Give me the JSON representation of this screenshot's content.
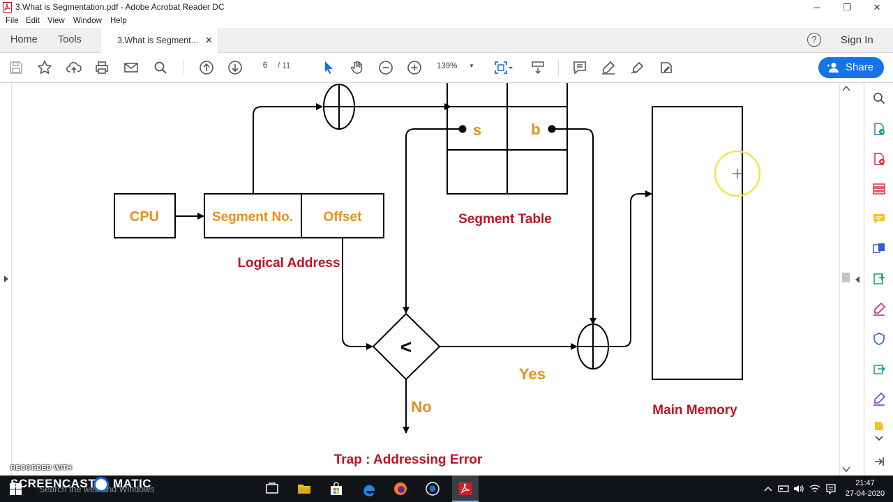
{
  "window": {
    "title": "3.What is Segmentation.pdf - Adobe Acrobat Reader DC",
    "minimize": "─",
    "restore": "❐",
    "close": "✕"
  },
  "menu": [
    "File",
    "Edit",
    "View",
    "Window",
    "Help"
  ],
  "tabs": {
    "home": "Home",
    "tools": "Tools",
    "document": "3.What is Segment...",
    "document_close": "✕",
    "help": "?",
    "sign_in": "Sign In"
  },
  "toolbar": {
    "page_current": "6",
    "page_total": "/ 11",
    "zoom": "139%",
    "zoom_arrow": "▼",
    "share": "Share"
  },
  "diagram": {
    "cpu": "CPU",
    "segment_no": "Segment No.",
    "offset": "Offset",
    "logical_address": "Logical Address",
    "s": "s",
    "b": "b",
    "segment_table": "Segment Table",
    "compare": "<",
    "yes": "Yes",
    "no": "No",
    "trap": "Trap : Addressing Error",
    "main_memory": "Main Memory"
  },
  "taskbar": {
    "search_placeholder": "Search the web and Windows",
    "time": "21:47",
    "date": "27-04-2020"
  },
  "watermark": {
    "line1": "RECORDED WITH",
    "line2a": "SCREENCAST",
    "line2b": "MATIC"
  },
  "colors": {
    "orange_label": "#e8901a",
    "red_label": "#c0131f",
    "share_blue": "#1473e6",
    "cursor_highlight": "#f2e44a"
  }
}
